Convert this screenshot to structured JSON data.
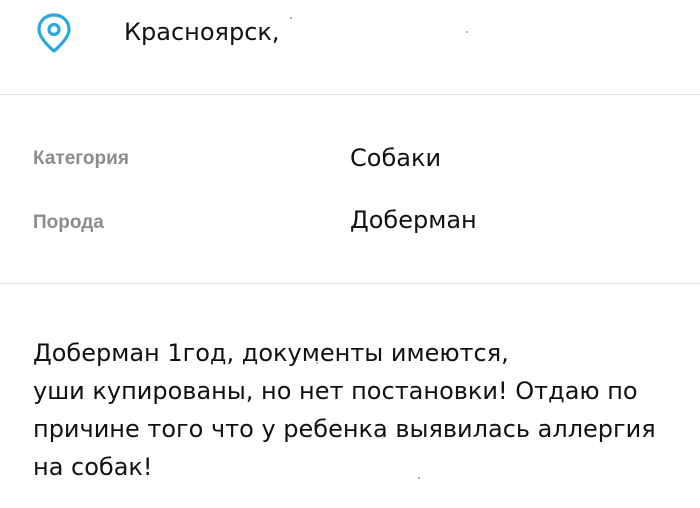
{
  "location": {
    "icon": "map-pin-icon",
    "icon_color": "#2aa8e0",
    "city": "Красноярск,"
  },
  "properties": [
    {
      "label": "Категория",
      "value": "Собаки"
    },
    {
      "label": "Порода",
      "value": "Доберман"
    }
  ],
  "description": {
    "text": "Доберман 1год,                        документы имеются,\nуши купированы, но нет постановки! Отдаю по\nпричине того что у ребенка выявилась аллергия\nна собак!"
  }
}
